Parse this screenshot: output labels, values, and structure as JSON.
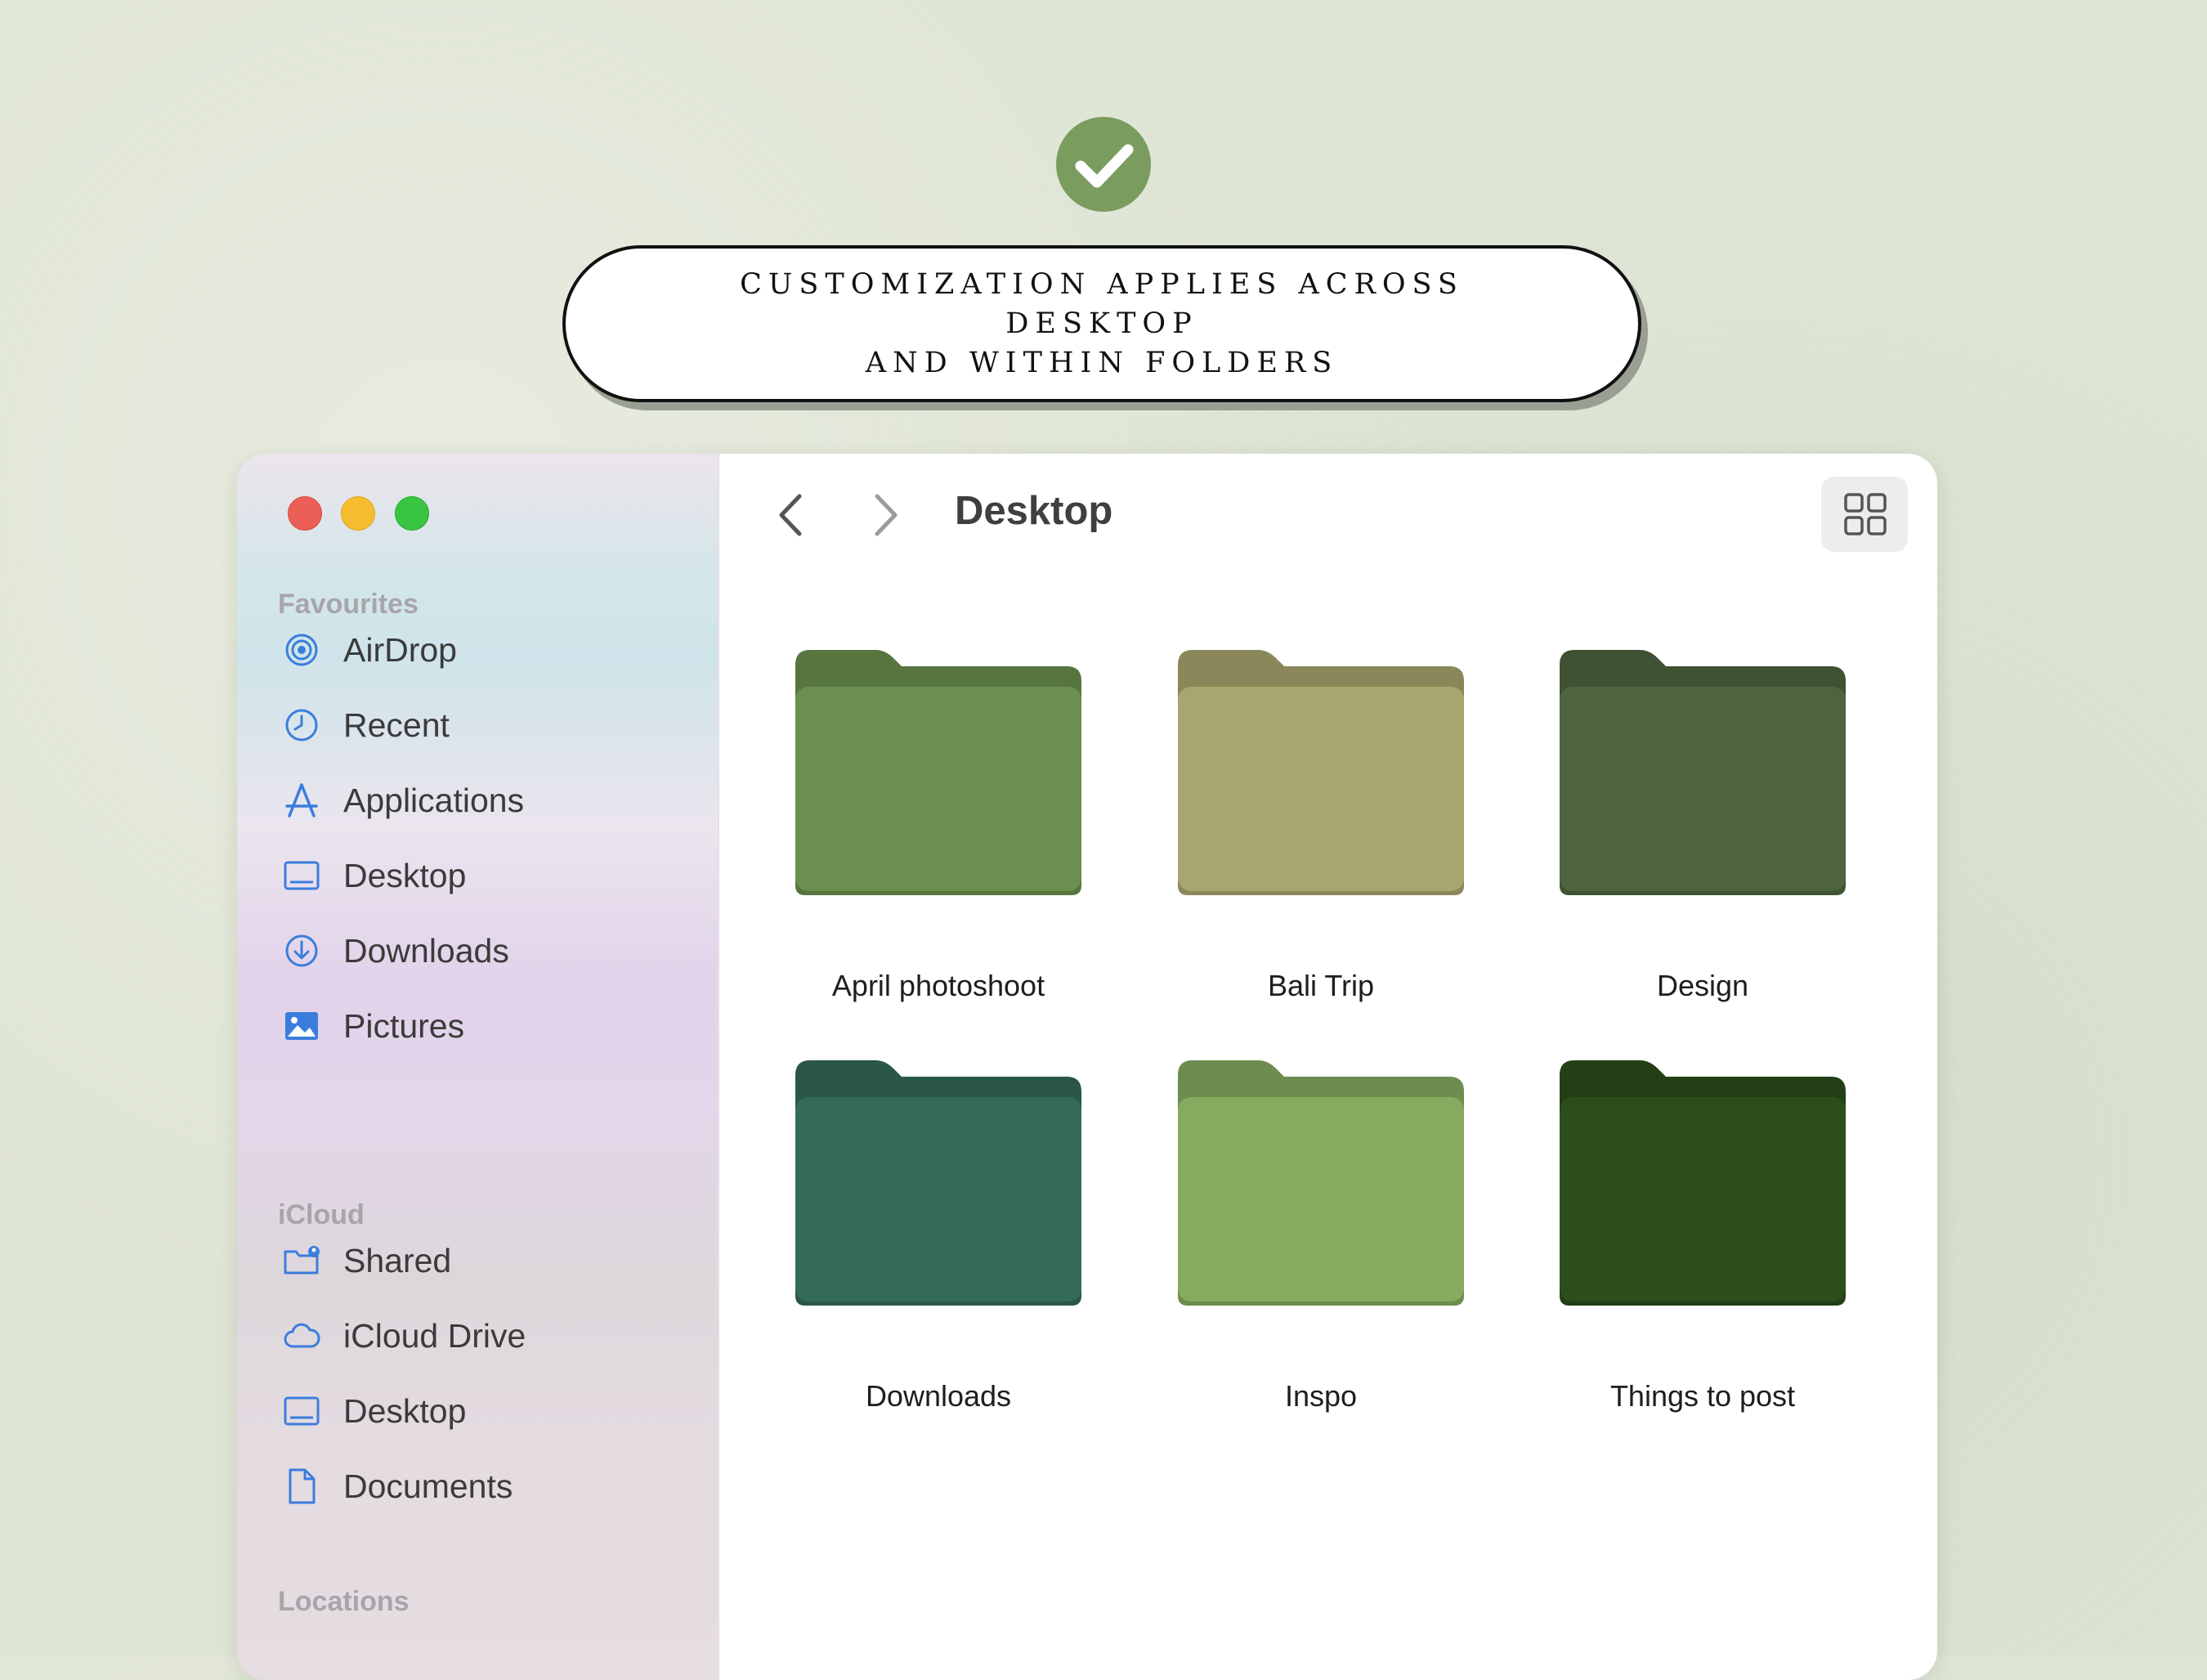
{
  "caption": {
    "line1": "CUSTOMIZATION APPLIES ACROSS DESKTOP",
    "line2": "AND WITHIN FOLDERS",
    "badge_icon": "checkmark-icon",
    "badge_color": "#7a9c5f"
  },
  "window": {
    "title": "Desktop",
    "nav_back_icon": "chevron-left-icon",
    "nav_forward_icon": "chevron-right-icon",
    "view_icon": "grid-view-icon"
  },
  "sidebar": {
    "favourites_label": "Favourites",
    "favourites": [
      {
        "label": "AirDrop",
        "icon": "airdrop-icon"
      },
      {
        "label": "Recent",
        "icon": "clock-icon"
      },
      {
        "label": "Applications",
        "icon": "applications-icon"
      },
      {
        "label": "Desktop",
        "icon": "desktop-icon"
      },
      {
        "label": "Downloads",
        "icon": "download-icon"
      },
      {
        "label": "Pictures",
        "icon": "photo-icon"
      }
    ],
    "icloud_label": "iCloud",
    "icloud": [
      {
        "label": "Shared",
        "icon": "shared-folder-icon"
      },
      {
        "label": "iCloud Drive",
        "icon": "cloud-icon"
      },
      {
        "label": "Desktop",
        "icon": "desktop-icon"
      },
      {
        "label": "Documents",
        "icon": "document-icon"
      }
    ],
    "locations_label": "Locations"
  },
  "folders": [
    {
      "name": "April photoshoot",
      "color": "#6b8f4e"
    },
    {
      "name": "Bali Trip",
      "color": "#a9a56e"
    },
    {
      "name": "Design",
      "color": "#4e6440"
    },
    {
      "name": "Downloads",
      "color": "#346b58"
    },
    {
      "name": "Inspo",
      "color": "#86ab5e"
    },
    {
      "name": "Things to post",
      "color": "#2d4e1b"
    }
  ]
}
